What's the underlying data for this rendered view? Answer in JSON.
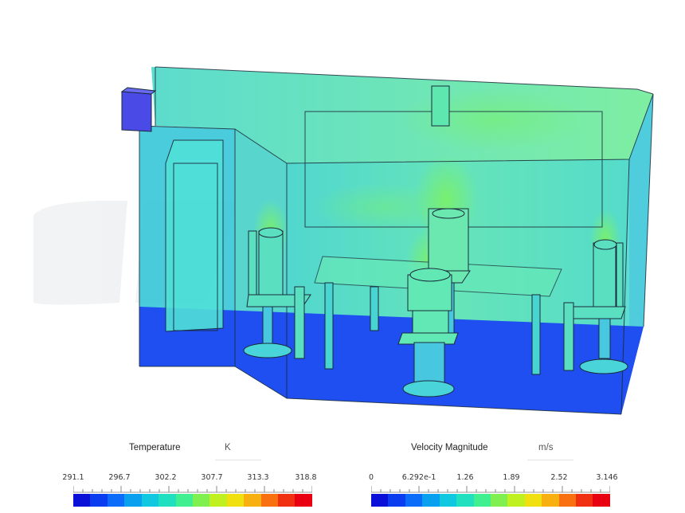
{
  "legends": [
    {
      "id": "temperature",
      "title": "Temperature",
      "unit": "K",
      "ticks": [
        "291.1",
        "296.7",
        "302.2",
        "307.7",
        "313.3",
        "318.8"
      ]
    },
    {
      "id": "velocity",
      "title": "Velocity Magnitude",
      "unit": "m/s",
      "ticks": [
        "0",
        "6.292e-1",
        "1.26",
        "1.89",
        "2.52",
        "3.146"
      ]
    }
  ],
  "colormap": [
    "#0a10d8",
    "#0a3cf0",
    "#0a6cf8",
    "#0aa0f0",
    "#10c8e0",
    "#20e0c0",
    "#40f090",
    "#80f050",
    "#c0f020",
    "#f0e010",
    "#f8b010",
    "#f87010",
    "#f03010",
    "#e80010"
  ],
  "colors": {
    "floor": "#1f4ff0",
    "ambient_air": "#3fd8c8",
    "warm_air": "#7af090",
    "inlet": "#4a4ae6",
    "edge": "#1a2a3a"
  }
}
